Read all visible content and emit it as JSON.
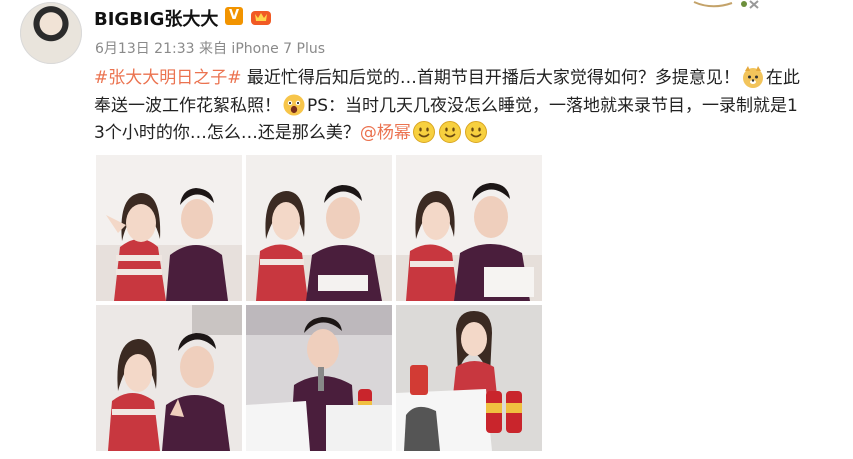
{
  "user": {
    "name": "BIGBIG张大大",
    "verified_badge": "V",
    "verified_icon": "verified-v-icon",
    "vip_icon": "crown-badge-icon"
  },
  "meta": {
    "timestamp": "6月13日 21:33",
    "source": "来自 iPhone 7 Plus"
  },
  "post": {
    "topic": "#张大大明日之子#",
    "text_1": " 最近忙得后知后觉的…首期节目开播后大家觉得如何？多提意见！",
    "emoji_1": "doge-emoji",
    "text_2": "在此奉送一波工作花絮私照！",
    "emoji_2": "shocked-emoji",
    "text_3": "PS：当时几天几夜没怎么睡觉，一落地就来录节目，一录制就是13个小时的你…怎么…还是那么美？",
    "mention": "@杨幂",
    "trailing_emojis": [
      "smile-emoji",
      "smile-emoji",
      "smile-emoji"
    ]
  },
  "photos": [
    {
      "name": "photo-1",
      "scene": "couple-peace-sign"
    },
    {
      "name": "photo-2",
      "scene": "couple-selfie"
    },
    {
      "name": "photo-3",
      "scene": "couple-selfie-2"
    },
    {
      "name": "photo-4",
      "scene": "couple-stage"
    },
    {
      "name": "photo-5",
      "scene": "host-with-microphone"
    },
    {
      "name": "photo-6",
      "scene": "guest-at-desk"
    }
  ],
  "colors": {
    "accent": "#eb7350",
    "text": "#222222",
    "meta": "#8a8a8a",
    "verified": "#f29400"
  }
}
